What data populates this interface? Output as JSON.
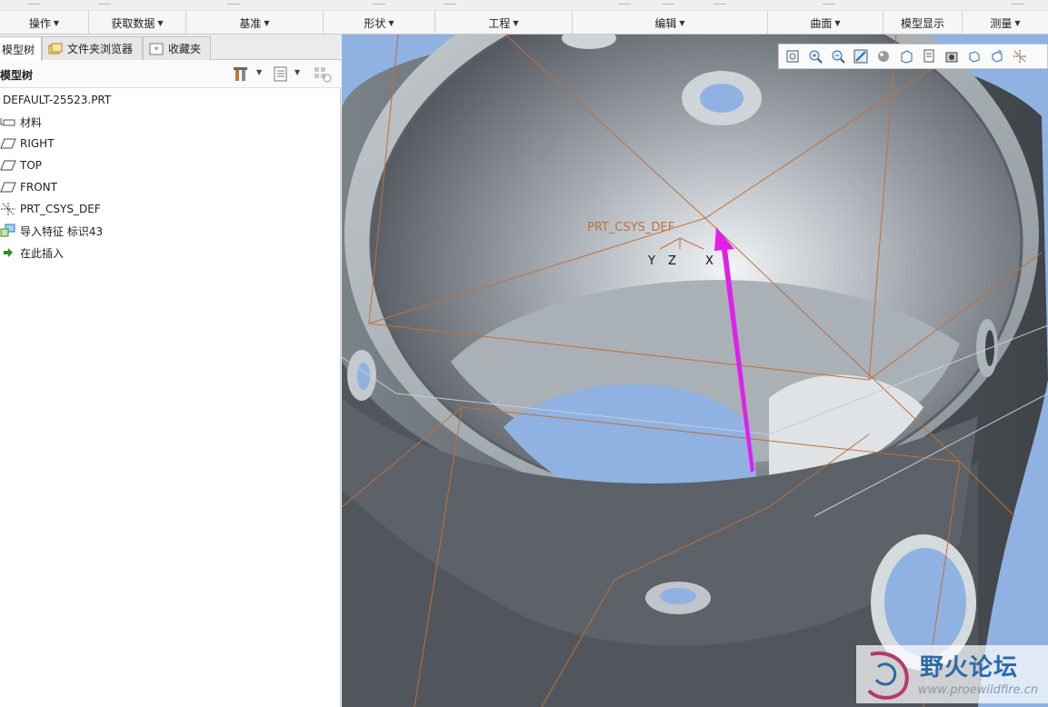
{
  "ribbon": {
    "groups": [
      {
        "label": "操作"
      },
      {
        "label": "获取数据"
      },
      {
        "label": "基准"
      },
      {
        "label": "形状"
      },
      {
        "label": "工程"
      },
      {
        "label": "编辑"
      },
      {
        "label": "曲面"
      },
      {
        "label": "模型显示"
      },
      {
        "label": "测量"
      }
    ]
  },
  "left_panel": {
    "tabs": [
      {
        "label": "模型树"
      },
      {
        "label": "文件夹浏览器"
      },
      {
        "label": "收藏夹"
      }
    ],
    "tree_header": {
      "title": "模型树"
    },
    "tree": [
      {
        "label": "DEFAULT-25523.PRT",
        "icon": "part-icon"
      },
      {
        "label": "材料",
        "icon": "material-icon"
      },
      {
        "label": "RIGHT",
        "icon": "datum-plane-icon"
      },
      {
        "label": "TOP",
        "icon": "datum-plane-icon"
      },
      {
        "label": "FRONT",
        "icon": "datum-plane-icon"
      },
      {
        "label": "PRT_CSYS_DEF",
        "icon": "csys-icon"
      },
      {
        "label": "导入特征 标识43",
        "icon": "import-feature-icon"
      },
      {
        "label": "在此插入",
        "icon": "insert-here-arrow-icon"
      }
    ]
  },
  "viewport": {
    "csys_label": "PRT_CSYS_DEF",
    "axis_labels": {
      "y": "Y",
      "z": "Z",
      "x": "X"
    },
    "toolbar_icons": [
      "refit-icon",
      "zoom-in-icon",
      "zoom-out-icon",
      "repaint-icon",
      "display-style-icon",
      "saved-orientations-icon",
      "view-manager-icon",
      "perspective-icon",
      "spin-center-icon",
      "annotation-display-icon",
      "datum-display-icon"
    ],
    "watermark": {
      "title": "野火论坛",
      "url": "www.proewildfire.cn"
    },
    "colors": {
      "background": "#8fb2e2",
      "model": "#6f767c",
      "datum": "#c0703a",
      "drag_arrow": "#e020e8"
    }
  }
}
